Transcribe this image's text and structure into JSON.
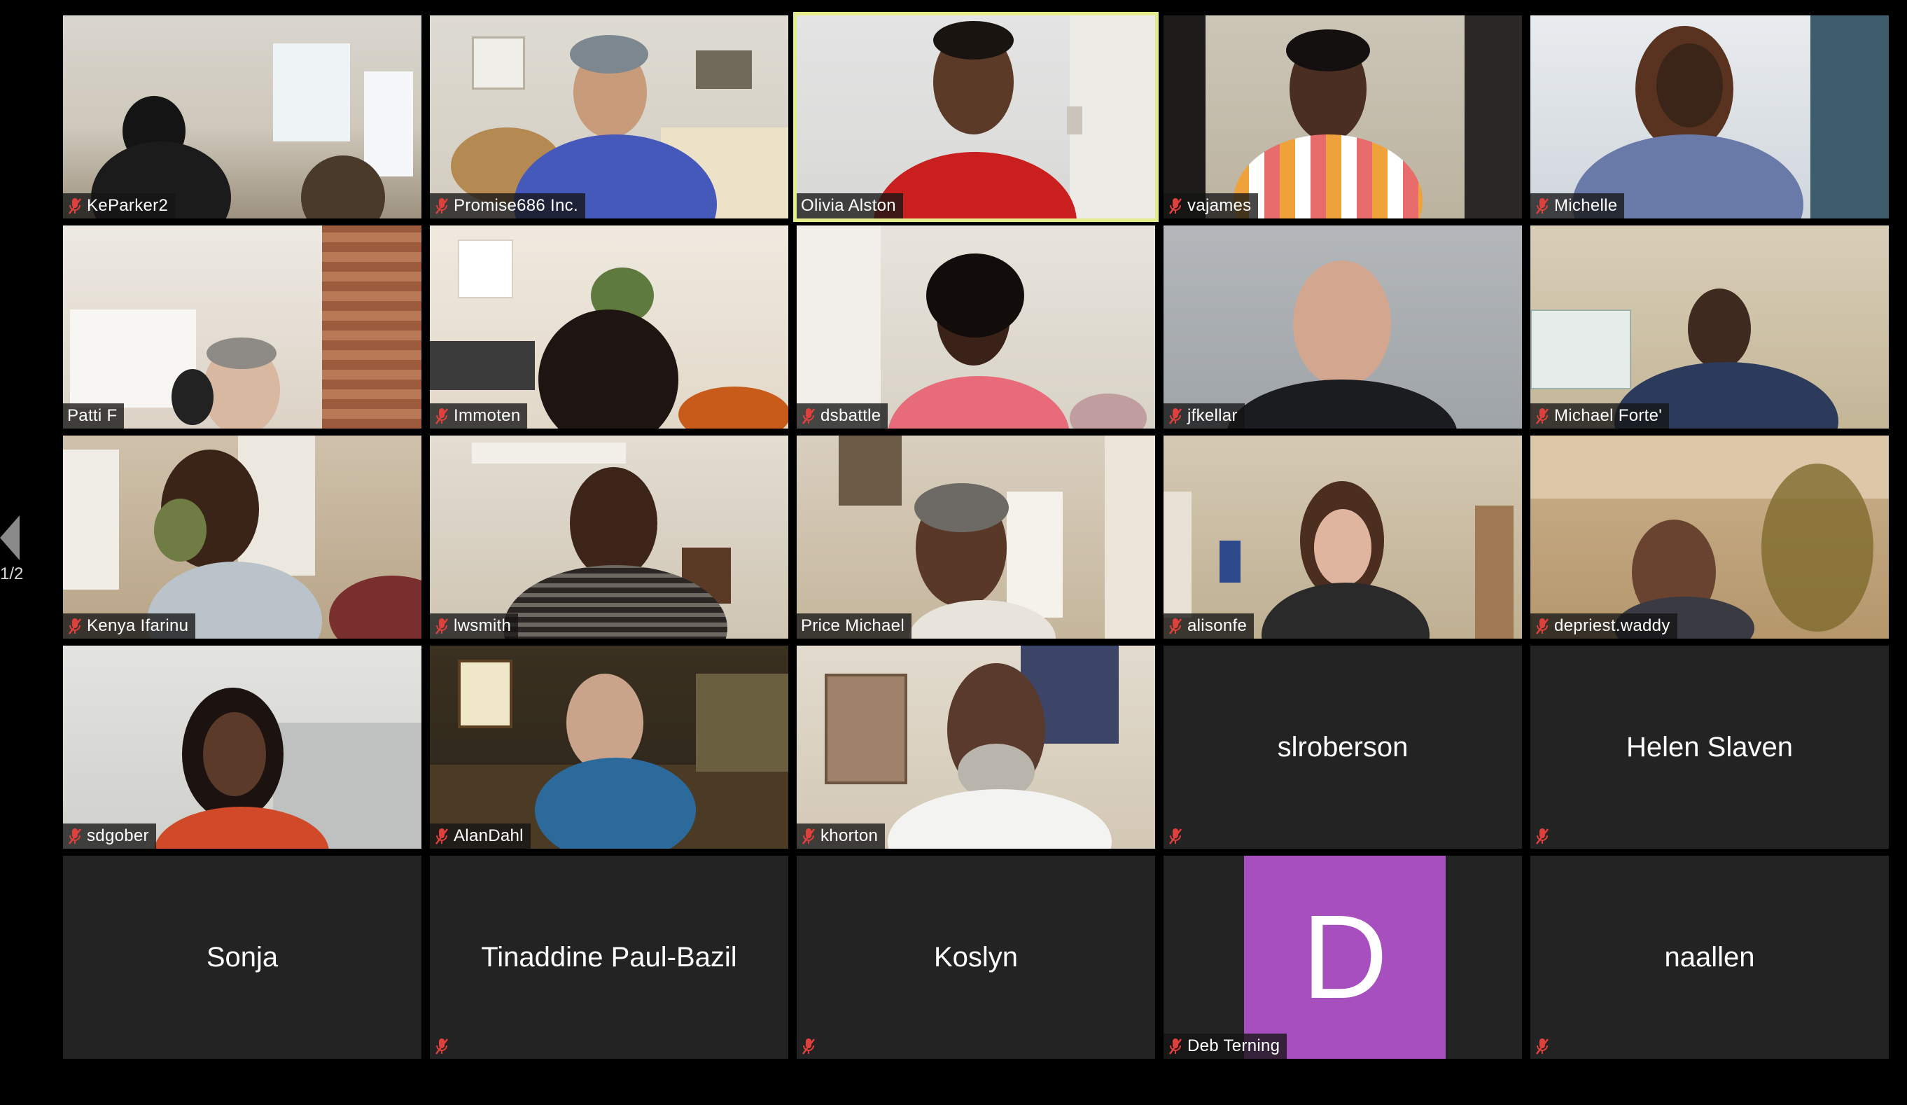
{
  "meeting": {
    "page_indicator": "1/2"
  },
  "participants": [
    {
      "name": "KeParker2",
      "muted": true
    },
    {
      "name": "Promise686 Inc.",
      "muted": true
    },
    {
      "name": "Olivia Alston",
      "muted": false,
      "active_speaker": true
    },
    {
      "name": "vajames",
      "muted": true
    },
    {
      "name": "Michelle",
      "muted": true
    },
    {
      "name": "Patti F",
      "muted": false
    },
    {
      "name": "Immoten",
      "muted": true
    },
    {
      "name": "dsbattle",
      "muted": true
    },
    {
      "name": "jfkellar",
      "muted": true
    },
    {
      "name": "Michael Forte'",
      "muted": true
    },
    {
      "name": "Kenya Ifarinu",
      "muted": true
    },
    {
      "name": "lwsmith",
      "muted": true
    },
    {
      "name": "Price Michael",
      "muted": false
    },
    {
      "name": "alisonfe",
      "muted": true
    },
    {
      "name": "depriest.waddy",
      "muted": true
    },
    {
      "name": "sdgober",
      "muted": true
    },
    {
      "name": "AlanDahl",
      "muted": true
    },
    {
      "name": "khorton",
      "muted": true
    },
    {
      "name": "slroberson",
      "muted": true,
      "video_off": true
    },
    {
      "name": "Helen Slaven",
      "muted": true,
      "video_off": true
    },
    {
      "name": "Sonja",
      "muted": false,
      "video_off": true
    },
    {
      "name": "Tinaddine Paul-Bazil",
      "muted": true,
      "video_off": true
    },
    {
      "name": "Koslyn",
      "muted": true,
      "video_off": true
    },
    {
      "name": "Deb Terning",
      "muted": true,
      "avatar_letter": "D",
      "avatar_color": "#a84fc0"
    },
    {
      "name": "naallen",
      "muted": true,
      "video_off": true
    }
  ],
  "colors": {
    "active_speaker_border": "#e5ec8c",
    "muted_icon": "#e0403c",
    "tile_background": "#232323"
  }
}
